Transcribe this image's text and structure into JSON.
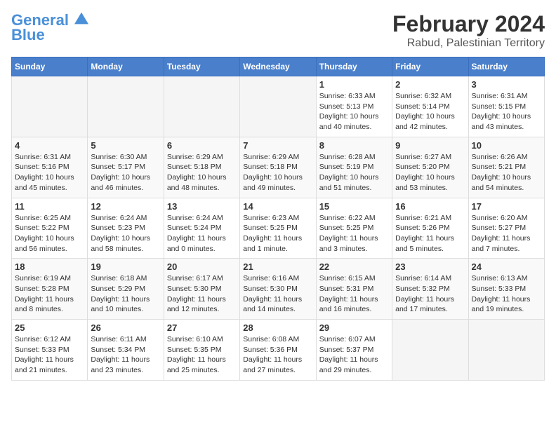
{
  "header": {
    "logo_line1": "General",
    "logo_line2": "Blue",
    "month_year": "February 2024",
    "location": "Rabud, Palestinian Territory"
  },
  "days_of_week": [
    "Sunday",
    "Monday",
    "Tuesday",
    "Wednesday",
    "Thursday",
    "Friday",
    "Saturday"
  ],
  "weeks": [
    [
      {
        "day": "",
        "info": ""
      },
      {
        "day": "",
        "info": ""
      },
      {
        "day": "",
        "info": ""
      },
      {
        "day": "",
        "info": ""
      },
      {
        "day": "1",
        "info": "Sunrise: 6:33 AM\nSunset: 5:13 PM\nDaylight: 10 hours\nand 40 minutes."
      },
      {
        "day": "2",
        "info": "Sunrise: 6:32 AM\nSunset: 5:14 PM\nDaylight: 10 hours\nand 42 minutes."
      },
      {
        "day": "3",
        "info": "Sunrise: 6:31 AM\nSunset: 5:15 PM\nDaylight: 10 hours\nand 43 minutes."
      }
    ],
    [
      {
        "day": "4",
        "info": "Sunrise: 6:31 AM\nSunset: 5:16 PM\nDaylight: 10 hours\nand 45 minutes."
      },
      {
        "day": "5",
        "info": "Sunrise: 6:30 AM\nSunset: 5:17 PM\nDaylight: 10 hours\nand 46 minutes."
      },
      {
        "day": "6",
        "info": "Sunrise: 6:29 AM\nSunset: 5:18 PM\nDaylight: 10 hours\nand 48 minutes."
      },
      {
        "day": "7",
        "info": "Sunrise: 6:29 AM\nSunset: 5:18 PM\nDaylight: 10 hours\nand 49 minutes."
      },
      {
        "day": "8",
        "info": "Sunrise: 6:28 AM\nSunset: 5:19 PM\nDaylight: 10 hours\nand 51 minutes."
      },
      {
        "day": "9",
        "info": "Sunrise: 6:27 AM\nSunset: 5:20 PM\nDaylight: 10 hours\nand 53 minutes."
      },
      {
        "day": "10",
        "info": "Sunrise: 6:26 AM\nSunset: 5:21 PM\nDaylight: 10 hours\nand 54 minutes."
      }
    ],
    [
      {
        "day": "11",
        "info": "Sunrise: 6:25 AM\nSunset: 5:22 PM\nDaylight: 10 hours\nand 56 minutes."
      },
      {
        "day": "12",
        "info": "Sunrise: 6:24 AM\nSunset: 5:23 PM\nDaylight: 10 hours\nand 58 minutes."
      },
      {
        "day": "13",
        "info": "Sunrise: 6:24 AM\nSunset: 5:24 PM\nDaylight: 11 hours\nand 0 minutes."
      },
      {
        "day": "14",
        "info": "Sunrise: 6:23 AM\nSunset: 5:25 PM\nDaylight: 11 hours\nand 1 minute."
      },
      {
        "day": "15",
        "info": "Sunrise: 6:22 AM\nSunset: 5:25 PM\nDaylight: 11 hours\nand 3 minutes."
      },
      {
        "day": "16",
        "info": "Sunrise: 6:21 AM\nSunset: 5:26 PM\nDaylight: 11 hours\nand 5 minutes."
      },
      {
        "day": "17",
        "info": "Sunrise: 6:20 AM\nSunset: 5:27 PM\nDaylight: 11 hours\nand 7 minutes."
      }
    ],
    [
      {
        "day": "18",
        "info": "Sunrise: 6:19 AM\nSunset: 5:28 PM\nDaylight: 11 hours\nand 8 minutes."
      },
      {
        "day": "19",
        "info": "Sunrise: 6:18 AM\nSunset: 5:29 PM\nDaylight: 11 hours\nand 10 minutes."
      },
      {
        "day": "20",
        "info": "Sunrise: 6:17 AM\nSunset: 5:30 PM\nDaylight: 11 hours\nand 12 minutes."
      },
      {
        "day": "21",
        "info": "Sunrise: 6:16 AM\nSunset: 5:30 PM\nDaylight: 11 hours\nand 14 minutes."
      },
      {
        "day": "22",
        "info": "Sunrise: 6:15 AM\nSunset: 5:31 PM\nDaylight: 11 hours\nand 16 minutes."
      },
      {
        "day": "23",
        "info": "Sunrise: 6:14 AM\nSunset: 5:32 PM\nDaylight: 11 hours\nand 17 minutes."
      },
      {
        "day": "24",
        "info": "Sunrise: 6:13 AM\nSunset: 5:33 PM\nDaylight: 11 hours\nand 19 minutes."
      }
    ],
    [
      {
        "day": "25",
        "info": "Sunrise: 6:12 AM\nSunset: 5:33 PM\nDaylight: 11 hours\nand 21 minutes."
      },
      {
        "day": "26",
        "info": "Sunrise: 6:11 AM\nSunset: 5:34 PM\nDaylight: 11 hours\nand 23 minutes."
      },
      {
        "day": "27",
        "info": "Sunrise: 6:10 AM\nSunset: 5:35 PM\nDaylight: 11 hours\nand 25 minutes."
      },
      {
        "day": "28",
        "info": "Sunrise: 6:08 AM\nSunset: 5:36 PM\nDaylight: 11 hours\nand 27 minutes."
      },
      {
        "day": "29",
        "info": "Sunrise: 6:07 AM\nSunset: 5:37 PM\nDaylight: 11 hours\nand 29 minutes."
      },
      {
        "day": "",
        "info": ""
      },
      {
        "day": "",
        "info": ""
      }
    ]
  ]
}
